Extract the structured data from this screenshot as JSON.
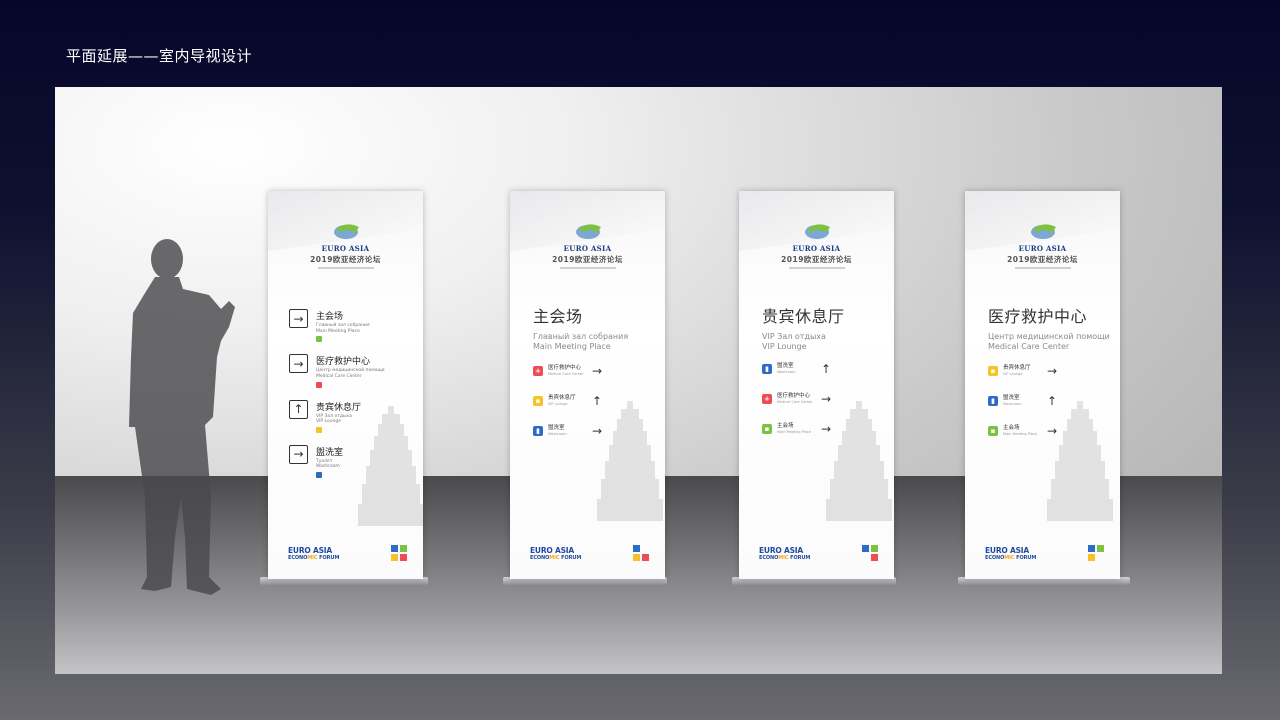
{
  "page_title": "平面延展——室内导视设计",
  "logo": {
    "euro_asia": "EURO ASIA",
    "forum_cn": "2019欧亚经济论坛",
    "bottom_line1": "EURO ASIA",
    "bottom_line2_a": "ECONO",
    "bottom_line2_b": "MIC",
    "bottom_line2_c": " FORUM"
  },
  "colors": {
    "red": "#ef4b55",
    "yellow": "#f7c224",
    "blue": "#2d6bc4",
    "green": "#7cc142",
    "logo_blue": "#1e4aa0"
  },
  "banner1": {
    "items": [
      {
        "cn": "主会场",
        "ru": "Главный зал собрания",
        "en": "Main Meeting Place",
        "arrow": "→",
        "icon_color": "#7cc142"
      },
      {
        "cn": "医疗救护中心",
        "ru": "Центр медицинской помощи",
        "en": "Medical Care Center",
        "arrow": "→",
        "icon_color": "#ef4b55"
      },
      {
        "cn": "贵宾休息厅",
        "ru": "VIP Зал отдыха",
        "en": "VIP Lounge",
        "arrow": "↑",
        "icon_color": "#f7c224"
      },
      {
        "cn": "盥洗室",
        "ru": "Туалет",
        "en": "Washroom",
        "arrow": "→",
        "icon_color": "#2d6bc4"
      }
    ]
  },
  "banner2": {
    "title_cn": "主会场",
    "title_ru": "Главный зал собрания",
    "title_en": "Main Meeting Place",
    "dest": [
      {
        "cn": "医疗救护中心",
        "sub": "Medical Care Center",
        "arrow": "→",
        "icon": "+",
        "icon_color": "#ef4b55"
      },
      {
        "cn": "贵宾休息厅",
        "sub": "VIP Lounge",
        "arrow": "↑",
        "icon": "▪",
        "icon_color": "#f7c224"
      },
      {
        "cn": "盥洗室",
        "sub": "Washroom",
        "arrow": "→",
        "icon": "▮",
        "icon_color": "#2d6bc4"
      }
    ]
  },
  "banner3": {
    "title_cn": "贵宾休息厅",
    "title_ru": "VIP Зал отдыха",
    "title_en": "VIP Lounge",
    "dest": [
      {
        "cn": "盥洗室",
        "sub": "Washroom",
        "arrow": "↑",
        "icon": "▮",
        "icon_color": "#2d6bc4"
      },
      {
        "cn": "医疗救护中心",
        "sub": "Medical Care Center",
        "arrow": "→",
        "icon": "+",
        "icon_color": "#ef4b55"
      },
      {
        "cn": "主会场",
        "sub": "Main Meeting Place",
        "arrow": "→",
        "icon": "▪",
        "icon_color": "#7cc142"
      }
    ]
  },
  "banner4": {
    "title_cn": "医疗救护中心",
    "title_ru": "Центр медицинской помощи",
    "title_en": "Medical Care Center",
    "dest": [
      {
        "cn": "贵宾休息厅",
        "sub": "VIP Lounge",
        "arrow": "→",
        "icon": "▪",
        "icon_color": "#f7c224"
      },
      {
        "cn": "盥洗室",
        "sub": "Washroom",
        "arrow": "↑",
        "icon": "▮",
        "icon_color": "#2d6bc4"
      },
      {
        "cn": "主会场",
        "sub": "Main Meeting Place",
        "arrow": "→",
        "icon": "▪",
        "icon_color": "#7cc142"
      }
    ]
  }
}
